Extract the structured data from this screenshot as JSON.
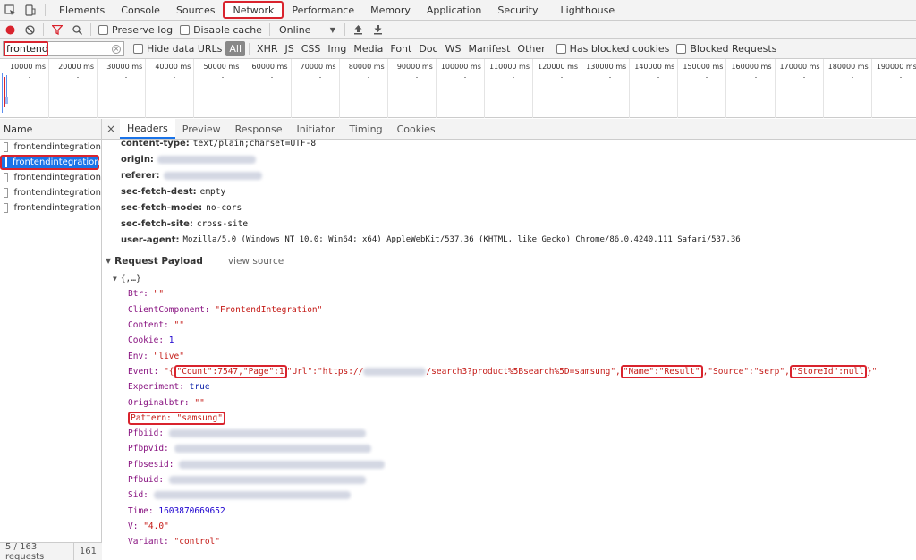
{
  "tabs": [
    "Elements",
    "Console",
    "Sources",
    "Network",
    "Performance",
    "Memory",
    "Application",
    "Security",
    "Lighthouse"
  ],
  "active_tab": "Network",
  "toolbar": {
    "preserve_log": "Preserve log",
    "disable_cache": "Disable cache",
    "throttle": "Online"
  },
  "filter": {
    "value": "frontend",
    "hide_data_urls": "Hide data URLs",
    "types": [
      "All",
      "XHR",
      "JS",
      "CSS",
      "Img",
      "Media",
      "Font",
      "Doc",
      "WS",
      "Manifest",
      "Other"
    ],
    "has_blocked_cookies": "Has blocked cookies",
    "blocked_requests": "Blocked Requests"
  },
  "timeline_ticks": [
    "10000 ms",
    "20000 ms",
    "30000 ms",
    "40000 ms",
    "50000 ms",
    "60000 ms",
    "70000 ms",
    "80000 ms",
    "90000 ms",
    "100000 ms",
    "110000 ms",
    "120000 ms",
    "130000 ms",
    "140000 ms",
    "150000 ms",
    "160000 ms",
    "170000 ms",
    "180000 ms",
    "190000 ms"
  ],
  "left": {
    "column_name": "Name",
    "requests": [
      "frontendintegration",
      "frontendintegration",
      "frontendintegration",
      "frontendintegration",
      "frontendintegration"
    ],
    "selected_index": 1,
    "footer_count": "5 / 163 requests",
    "footer_size": "161"
  },
  "detail_tabs": [
    "Headers",
    "Preview",
    "Response",
    "Initiator",
    "Timing",
    "Cookies"
  ],
  "active_detail_tab": "Headers",
  "headers": [
    {
      "key": "content-type:",
      "value": "text/plain;charset=UTF-8"
    },
    {
      "key": "origin:",
      "value": ""
    },
    {
      "key": "referer:",
      "value": ""
    },
    {
      "key": "sec-fetch-dest:",
      "value": "empty"
    },
    {
      "key": "sec-fetch-mode:",
      "value": "no-cors"
    },
    {
      "key": "sec-fetch-site:",
      "value": "cross-site"
    },
    {
      "key": "user-agent:",
      "value": "Mozilla/5.0 (Windows NT 10.0; Win64; x64) AppleWebKit/537.36 (KHTML, like Gecko) Chrome/86.0.4240.111 Safari/537.36"
    }
  ],
  "payload": {
    "title": "Request Payload",
    "view_source": "view source",
    "root": "{,…}",
    "fields": {
      "btr_k": "Btr:",
      "btr_v": "\"\"",
      "cc_k": "ClientComponent:",
      "cc_v": "\"FrontendIntegration\"",
      "content_k": "Content:",
      "content_v": "\"\"",
      "cookie_k": "Cookie:",
      "cookie_v": "1",
      "env_k": "Env:",
      "env_v": "\"live\"",
      "event_k": "Event:",
      "event_open": "\"{",
      "event_count": "\"Count\":7547,\"Page\":1",
      "event_url": "\"Url\":\"https://",
      "event_url_tail": "/search3?product%5Bsearch%5D=samsung\",",
      "event_name": "\"Name\":\"Result\"",
      "event_source": ",\"Source\":\"serp\",",
      "event_store": "\"StoreId\":null",
      "event_close": "}\"",
      "exp_k": "Experiment:",
      "exp_v": "true",
      "obtr_k": "Originalbtr:",
      "obtr_v": "\"\"",
      "pattern": "Pattern: \"samsung\"",
      "pfbiid_k": "Pfbiid:",
      "pfbpvid_k": "Pfbpvid:",
      "pfbsesid_k": "Pfbsesid:",
      "pfbuid_k": "Pfbuid:",
      "sid_k": "Sid:",
      "time_k": "Time:",
      "time_v": "1603870669652",
      "v_k": "V:",
      "v_v": "\"4.0\"",
      "variant_k": "Variant:",
      "variant_v": "\"control\""
    }
  }
}
